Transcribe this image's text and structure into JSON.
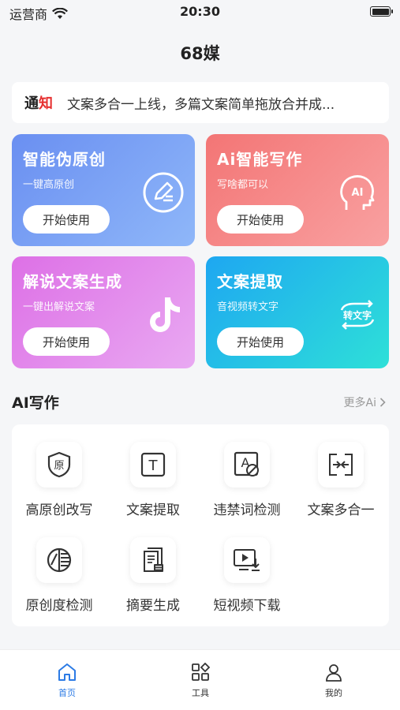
{
  "status_bar": {
    "carrier": "运营商",
    "time": "20:30"
  },
  "header": {
    "title": "68媒"
  },
  "notice": {
    "tag_1": "通",
    "tag_2": "知",
    "text": "文案多合一上线，多篇文案简单拖放合并成..."
  },
  "cards": [
    {
      "title": "智能伪原创",
      "subtitle": "一键高原创",
      "button": "开始使用",
      "icon": "edit-circle-icon"
    },
    {
      "title": "Ai智能写作",
      "subtitle": "写啥都可以",
      "button": "开始使用",
      "icon": "ai-head-icon"
    },
    {
      "title": "解说文案生成",
      "subtitle": "一键出解说文案",
      "button": "开始使用",
      "icon": "tiktok-icon"
    },
    {
      "title": "文案提取",
      "subtitle": "音视频转文字",
      "button": "开始使用",
      "icon": "convert-text-icon",
      "icon_text": "转文字"
    }
  ],
  "ai_section": {
    "title": "AI写作",
    "more": "更多Ai"
  },
  "tools": [
    {
      "label": "高原创改写",
      "icon": "shield-original-icon",
      "icon_text": "原"
    },
    {
      "label": "文案提取",
      "icon": "text-box-icon",
      "icon_text": "T"
    },
    {
      "label": "违禁词检测",
      "icon": "banned-word-icon",
      "icon_text": "A"
    },
    {
      "label": "文案多合一",
      "icon": "merge-icon"
    },
    {
      "label": "原创度检测",
      "icon": "pie-check-icon"
    },
    {
      "label": "摘要生成",
      "icon": "document-icon"
    },
    {
      "label": "短视频下载",
      "icon": "video-download-icon"
    }
  ],
  "tabbar": [
    {
      "label": "首页",
      "icon": "home-icon",
      "active": true
    },
    {
      "label": "工具",
      "icon": "grid-icon",
      "active": false
    },
    {
      "label": "我的",
      "icon": "user-icon",
      "active": false
    }
  ],
  "colors": {
    "accent": "#2c7be5",
    "notice_red": "#e63131"
  }
}
